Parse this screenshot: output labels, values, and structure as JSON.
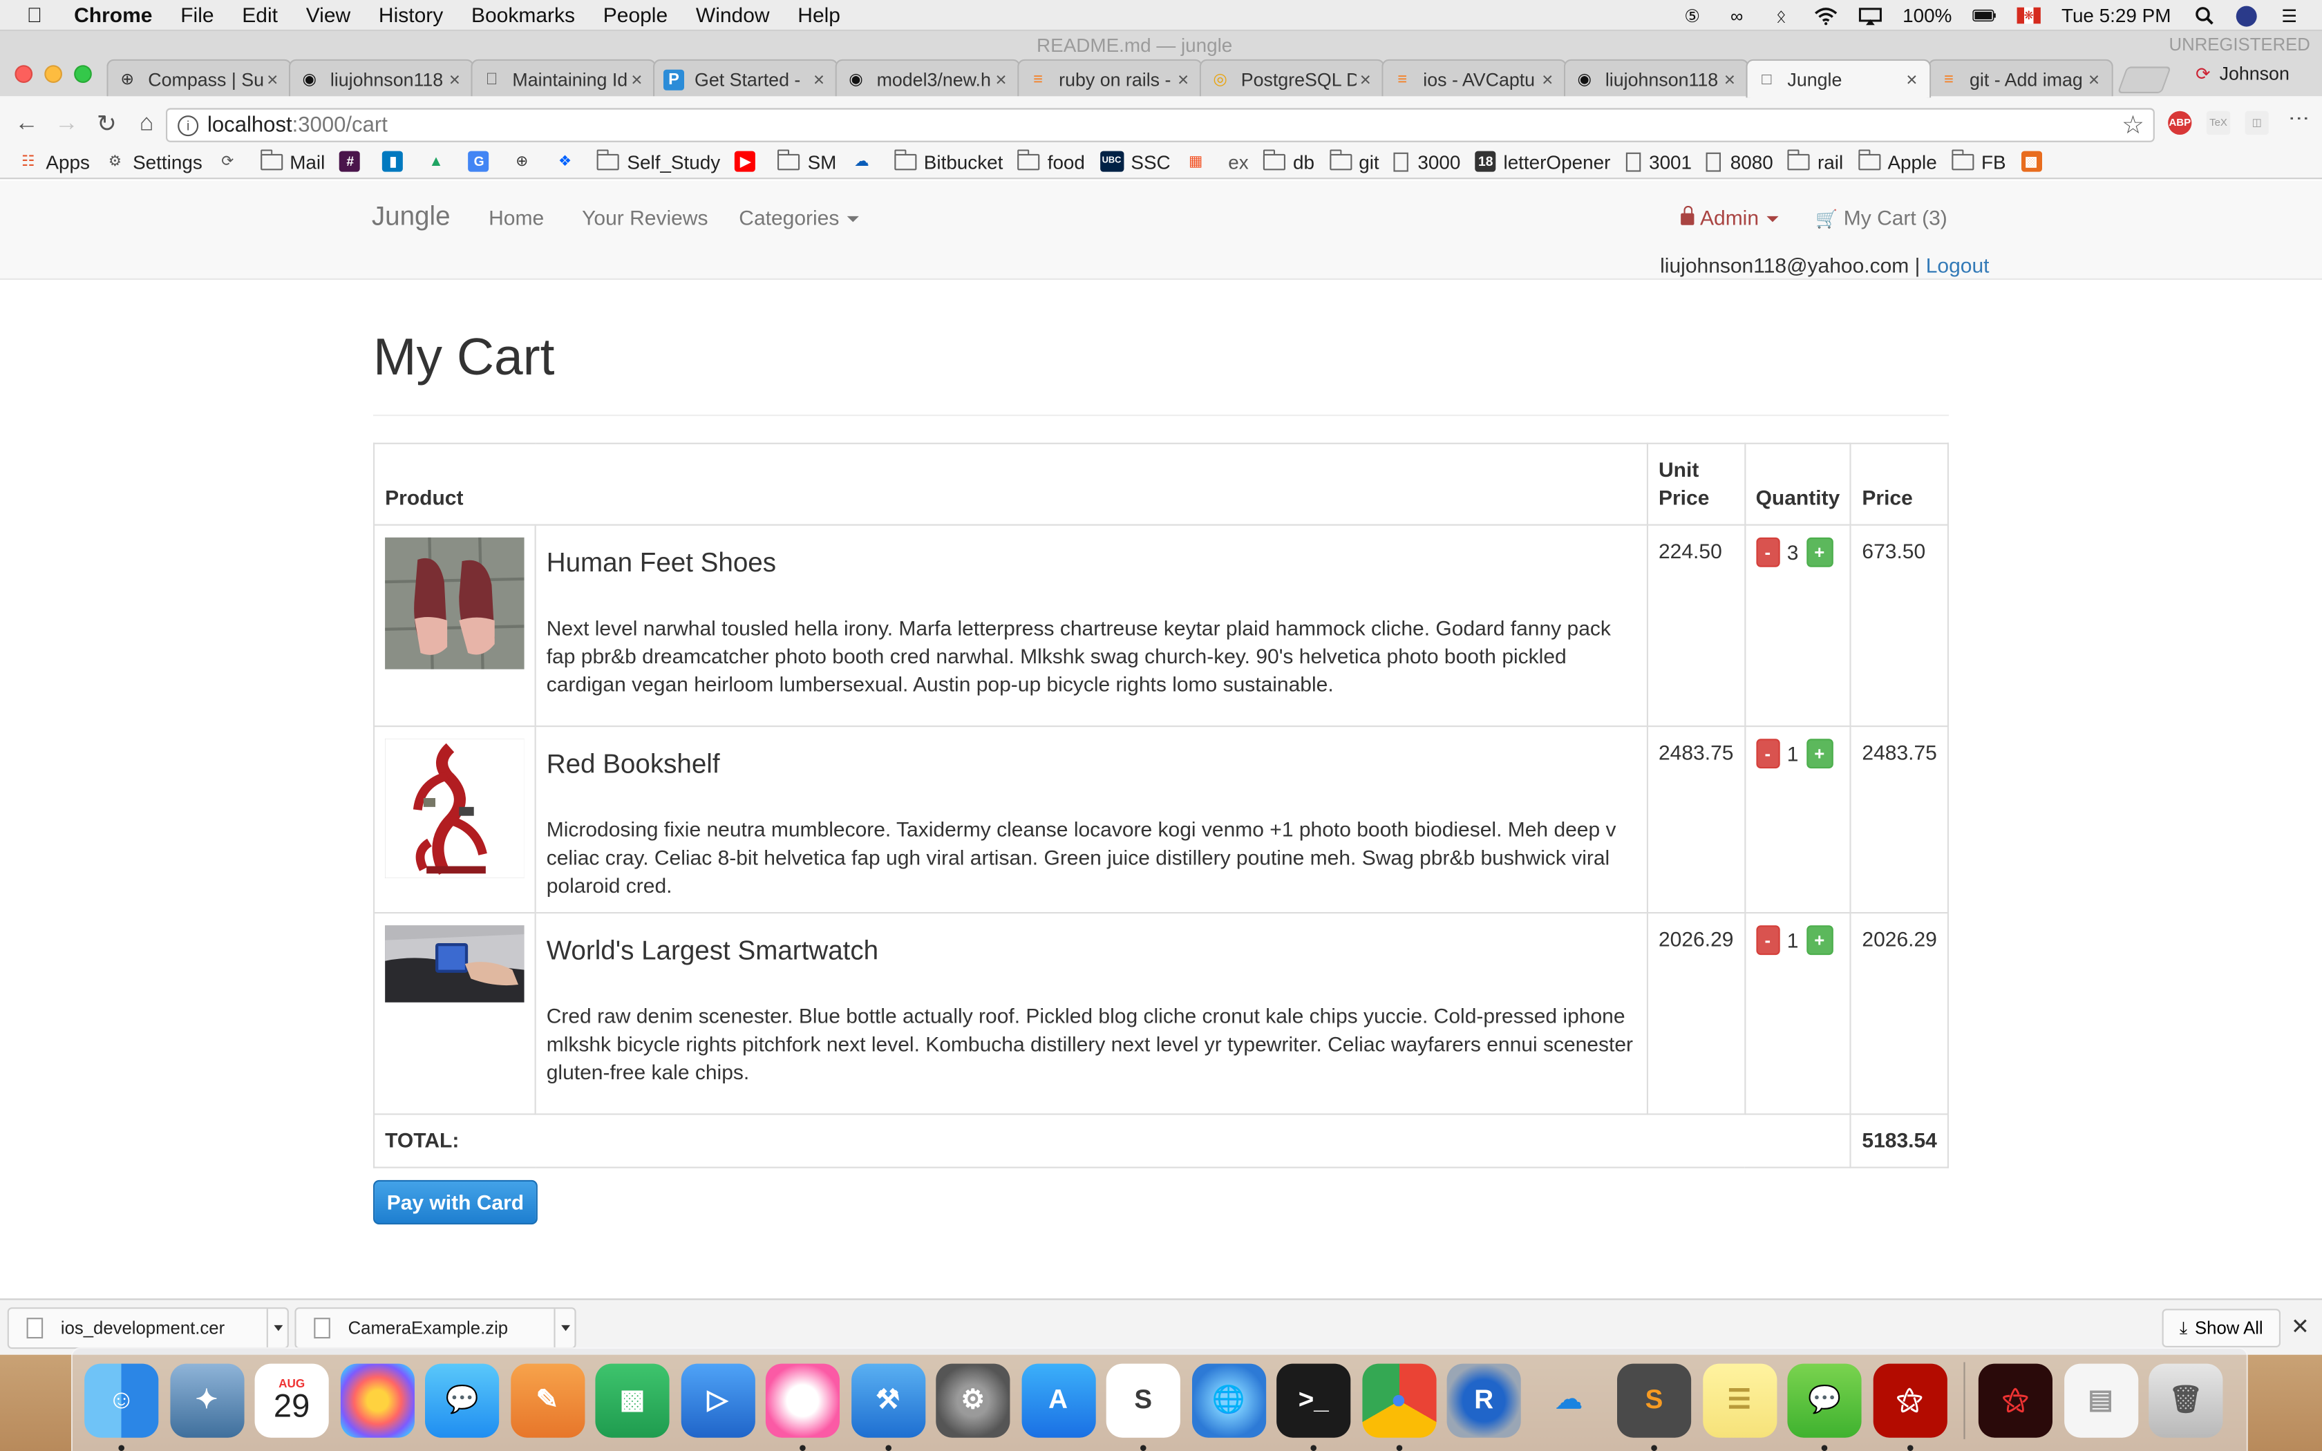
{
  "menubar": {
    "app": "Chrome",
    "items": [
      "File",
      "Edit",
      "View",
      "History",
      "Bookmarks",
      "People",
      "Window",
      "Help"
    ],
    "battery": "100%",
    "clock": "Tue 5:29 PM"
  },
  "window": {
    "title": "README.md — jungle",
    "unregistered": "UNREGISTERED",
    "profile": "Johnson"
  },
  "tabs": [
    {
      "label": "Compass | Su",
      "icon": "compass-icon"
    },
    {
      "label": "liujohnson118",
      "icon": "github-icon"
    },
    {
      "label": "Maintaining Id",
      "icon": "apple-icon"
    },
    {
      "label": "Get Started -",
      "icon": "p-logo-icon"
    },
    {
      "label": "model3/new.h",
      "icon": "github-icon"
    },
    {
      "label": "ruby on rails -",
      "icon": "stackoverflow-icon"
    },
    {
      "label": "PostgreSQL D",
      "icon": "chrome-icon"
    },
    {
      "label": "ios - AVCaptu",
      "icon": "stackoverflow-icon"
    },
    {
      "label": "liujohnson118",
      "icon": "github-icon"
    },
    {
      "label": "Jungle",
      "icon": "page-icon",
      "active": true
    },
    {
      "label": "git - Add imag",
      "icon": "stackoverflow-icon"
    }
  ],
  "address": {
    "host": "localhost",
    "path": ":3000/cart"
  },
  "bookmarks": [
    {
      "label": "Apps",
      "kind": "apps"
    },
    {
      "label": "Settings",
      "kind": "gear"
    },
    {
      "label": "",
      "kind": "history"
    },
    {
      "label": "Mail",
      "kind": "folder"
    },
    {
      "label": "",
      "kind": "slack"
    },
    {
      "label": "",
      "kind": "trello"
    },
    {
      "label": "",
      "kind": "drive"
    },
    {
      "label": "",
      "kind": "translate"
    },
    {
      "label": "",
      "kind": "plus"
    },
    {
      "label": "",
      "kind": "dropbox"
    },
    {
      "label": "Self_Study",
      "kind": "folder"
    },
    {
      "label": "",
      "kind": "youtube"
    },
    {
      "label": "SM",
      "kind": "folder"
    },
    {
      "label": "",
      "kind": "onedrive"
    },
    {
      "label": "Bitbucket",
      "kind": "folder"
    },
    {
      "label": "food",
      "kind": "folder"
    },
    {
      "label": "SSC",
      "kind": "ubc"
    },
    {
      "label": "",
      "kind": "microsoft"
    },
    {
      "label": "ex",
      "kind": "text"
    },
    {
      "label": "db",
      "kind": "folder"
    },
    {
      "label": "git",
      "kind": "folder"
    },
    {
      "label": "3000",
      "kind": "page"
    },
    {
      "label": "letterOpener",
      "kind": "eighteen"
    },
    {
      "label": "3001",
      "kind": "page"
    },
    {
      "label": "8080",
      "kind": "page"
    },
    {
      "label": "rail",
      "kind": "folder"
    },
    {
      "label": "Apple",
      "kind": "folder"
    },
    {
      "label": "FB",
      "kind": "folder"
    },
    {
      "label": "",
      "kind": "office"
    }
  ],
  "site": {
    "brand": "Jungle",
    "nav": {
      "home": "Home",
      "reviews": "Your Reviews",
      "categories": "Categories"
    },
    "admin": "Admin",
    "cart": "My Cart (3)",
    "user_email": "liujohnson118@yahoo.com",
    "separator": "|",
    "logout": "Logout"
  },
  "page": {
    "title": "My Cart",
    "headers": {
      "product": "Product",
      "unit_price": "Unit Price",
      "quantity": "Quantity",
      "price": "Price"
    },
    "minus": "-",
    "plus": "+",
    "items": [
      {
        "name": "Human Feet Shoes",
        "description": "Next level narwhal tousled hella irony. Marfa letterpress chartreuse keytar plaid hammock cliche. Godard fanny pack fap pbr&b dreamcatcher photo booth cred narwhal. Mlkshk swag church-key. 90's helvetica photo booth pickled cardigan vegan heirloom lumbersexual. Austin pop-up bicycle rights lomo sustainable.",
        "unit_price": "224.50",
        "quantity": "3",
        "price": "673.50"
      },
      {
        "name": "Red Bookshelf",
        "description": "Microdosing fixie neutra mumblecore. Taxidermy cleanse locavore kogi venmo +1 photo booth biodiesel. Meh deep v celiac cray. Celiac 8-bit helvetica fap ugh viral artisan. Green juice distillery poutine meh. Swag pbr&b bushwick viral polaroid cred.",
        "unit_price": "2483.75",
        "quantity": "1",
        "price": "2483.75"
      },
      {
        "name": "World's Largest Smartwatch",
        "description": "Cred raw denim scenester. Blue bottle actually roof. Pickled blog cliche cronut kale chips yuccie. Cold-pressed iphone mlkshk bicycle rights pitchfork next level. Kombucha distillery next level yr typewriter. Celiac wayfarers ennui scenester gluten-free kale chips.",
        "unit_price": "2026.29",
        "quantity": "1",
        "price": "2026.29"
      }
    ],
    "total_label": "TOTAL:",
    "total": "5183.54",
    "pay_button": "Pay with Card"
  },
  "downloads": {
    "items": [
      "ios_development.cer",
      "CameraExample.zip"
    ],
    "show_all": "Show All"
  },
  "dock": {
    "calendar_month": "AUG",
    "calendar_day": "29",
    "apps": [
      "finder",
      "eagle-app",
      "calendar",
      "photos",
      "messages",
      "pages",
      "numbers",
      "keynote",
      "itunes",
      "xcode",
      "system-preferences",
      "app-store",
      "slack",
      "globe",
      "terminal",
      "chrome",
      "r",
      "onedrive",
      "sublime-text",
      "notes",
      "wechat",
      "acrobat",
      "acrobat-window",
      "preview-window",
      "trash"
    ]
  }
}
